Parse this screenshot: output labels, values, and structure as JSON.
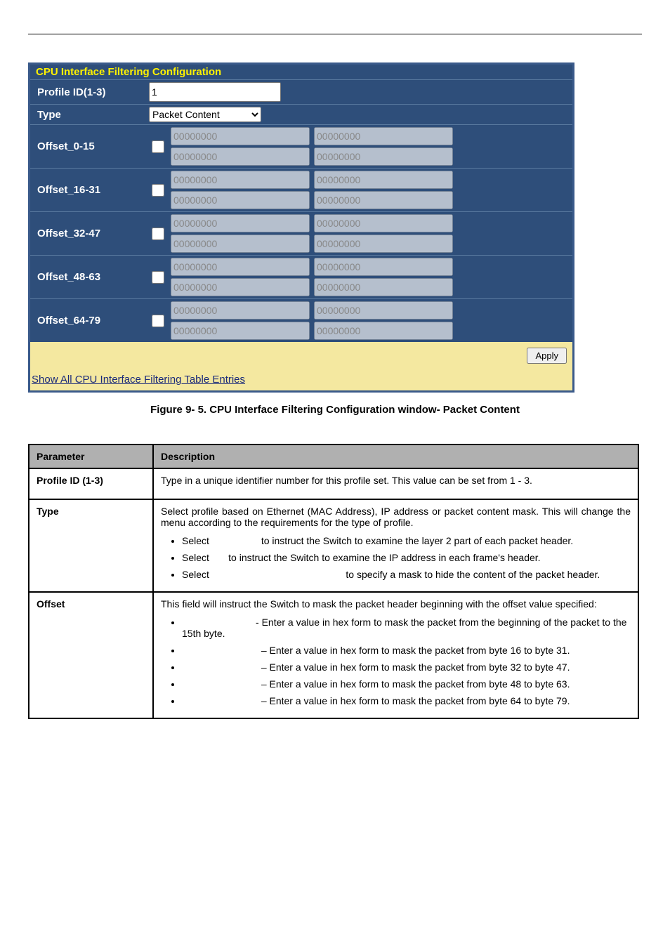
{
  "cfg": {
    "title": "CPU Interface Filtering Configuration",
    "profileLabel": "Profile ID(1-3)",
    "profileValue": "1",
    "typeLabel": "Type",
    "typeValue": "Packet Content",
    "offsets": [
      {
        "label": "Offset_0-15",
        "v": "00000000"
      },
      {
        "label": "Offset_16-31",
        "v": "00000000"
      },
      {
        "label": "Offset_32-47",
        "v": "00000000"
      },
      {
        "label": "Offset_48-63",
        "v": "00000000"
      },
      {
        "label": "Offset_64-79",
        "v": "00000000"
      }
    ],
    "applyLabel": "Apply",
    "linkText": "Show All CPU Interface Filtering Table Entries"
  },
  "caption": "Figure 9- 5. CPU Interface Filtering Configuration window- Packet Content",
  "table": {
    "h1": "Parameter",
    "h2": "Description",
    "rows": [
      {
        "label": "Profile ID (1-3)",
        "text": "Type in a unique identifier number for this profile set. This value can be set from 1 - 3."
      },
      {
        "label": "Type",
        "intro": "Select profile based on Ethernet (MAC Address), IP address or packet content mask. This will change the menu according to the requirements for the type of profile.",
        "items": [
          "Select                   to instruct the Switch to examine the layer 2 part of each packet header.",
          "Select       to instruct the Switch to examine the IP address in each frame's header.",
          "Select                                                  to specify a mask to hide the content of the packet header."
        ]
      },
      {
        "label": "Offset",
        "intro": "This field will instruct the Switch to mask the packet header beginning with the offset value specified:",
        "items": [
          "                           - Enter a value in hex form to mask the packet from the beginning of the packet to the 15th byte.",
          "                             – Enter a value in hex form to mask the packet from byte 16 to byte 31.",
          "                             – Enter a value in hex form to mask the packet from byte 32 to byte 47.",
          "                             – Enter a value in hex form to mask the packet from byte 48 to byte 63.",
          "                             – Enter a value in hex form to mask the packet from byte 64 to byte 79."
        ]
      }
    ]
  }
}
